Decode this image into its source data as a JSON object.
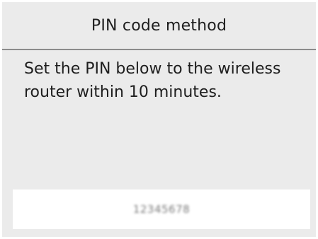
{
  "header": {
    "title": "PIN code method"
  },
  "message": {
    "text": "Set the PIN below to the wireless router within 10 minutes."
  },
  "pin": {
    "value": "12345678"
  }
}
